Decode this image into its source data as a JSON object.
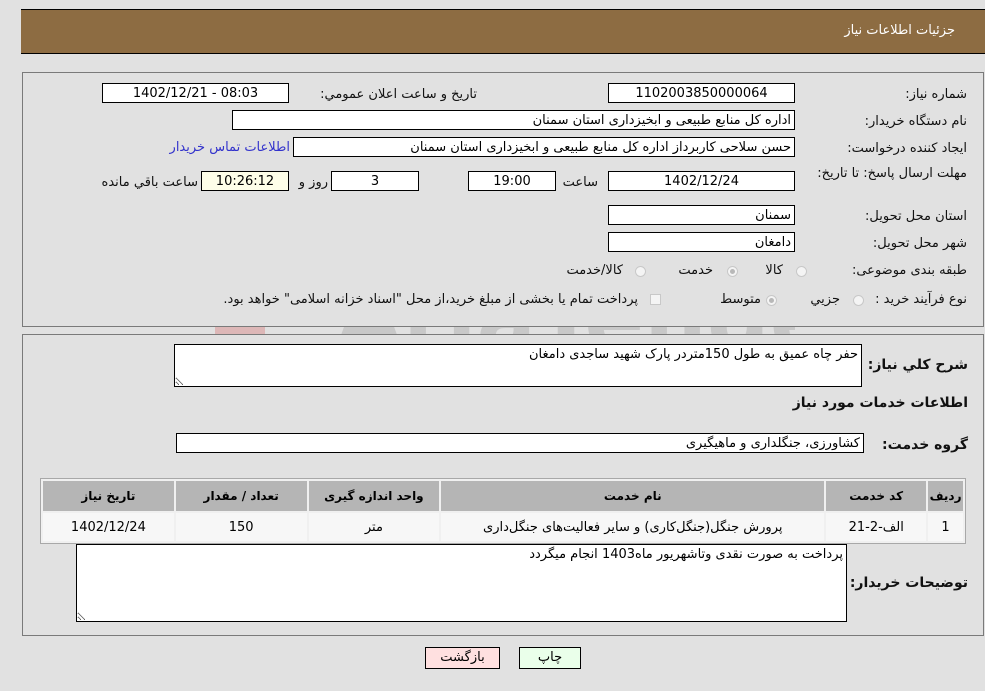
{
  "header": {
    "title": "جزئيات اطلاعات نياز"
  },
  "details": {
    "need_number_label": "شماره نياز:",
    "need_number": "1102003850000064",
    "announce_label": "تاريخ و ساعت اعلان عمومي:",
    "announce_value": "1402/12/21 - 08:03",
    "buyer_org_label": "نام دستگاه خريدار:",
    "buyer_org": "اداره کل منابع طبیعی و ابخیزداری استان سمنان",
    "creator_label": "ايجاد کننده درخواست:",
    "creator": "حسن سلاحی کاربرداز اداره کل منابع طبیعی و ابخیزداری استان سمنان",
    "contact_link": "اطلاعات تماس خريدار",
    "deadline_label": "مهلت ارسال پاسخ: تا تاريخ:",
    "deadline_date": "1402/12/24",
    "time_label": "ساعت",
    "deadline_time": "19:00",
    "days_value": "3",
    "days_label": "روز و",
    "remaining_time": "10:26:12",
    "remaining_label": "ساعت باقي مانده",
    "province_label": "استان محل تحويل:",
    "province": "سمنان",
    "city_label": "شهر محل تحويل:",
    "city": "دامغان",
    "category_label": "طبقه بندی موضوعی:",
    "category_options": [
      {
        "label": "کالا",
        "checked": false
      },
      {
        "label": "خدمت",
        "checked": true
      },
      {
        "label": "کالا/خدمت",
        "checked": false
      }
    ],
    "process_label": "نوع فرآيند خريد :",
    "process_options": [
      {
        "label": "جزيي",
        "checked": false
      },
      {
        "label": "متوسط",
        "checked": true
      }
    ],
    "payment_note": "پرداخت تمام يا بخشی از مبلغ خريد،از محل \"اسناد خزانه اسلامی\" خواهد بود."
  },
  "description": {
    "label": "شرح کلي نياز:",
    "value": "حفر چاه عمیق به طول 150متردر پارک شهید ساجدی دامغان"
  },
  "services": {
    "section_title": "اطلاعات خدمات مورد نياز",
    "group_label": "گروه خدمت:",
    "group_value": "کشاورزی، جنگلداری و ماهیگیری",
    "columns": [
      "رديف",
      "کد خدمت",
      "نام خدمت",
      "واحد اندازه گيری",
      "تعداد / مقدار",
      "تاريخ نياز"
    ],
    "rows": [
      [
        "1",
        "الف-2-21",
        "پرورش جنگل(جنگل‌کاری) و سایر فعالیت‌های جنگل‌داری",
        "متر",
        "150",
        "1402/12/24"
      ]
    ]
  },
  "buyer_notes": {
    "label": "توضيحات خريدار:",
    "value": "پرداخت به صورت نقدی وتاشهریور ماه1403 انجام میگردد"
  },
  "buttons": {
    "print": "چاپ",
    "back": "بازگشت"
  },
  "colors": {
    "header_bg": "#8d6c42",
    "print_bg": "#eaffea",
    "back_bg": "#ffe0e0",
    "link": "#3333cc"
  }
}
